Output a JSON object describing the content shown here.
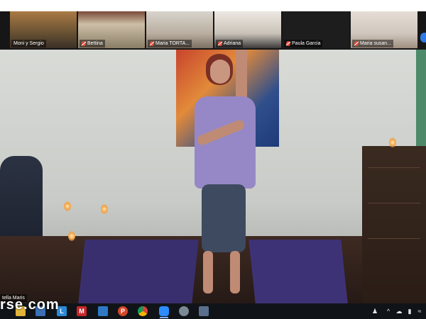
{
  "participants": [
    {
      "name": "Moni y Sergio",
      "muted": false
    },
    {
      "name": "Bettina",
      "muted": true
    },
    {
      "name": "Maria TORTA...",
      "muted": true
    },
    {
      "name": "Adriana",
      "muted": true
    },
    {
      "name": "Paula Garcia",
      "muted": true
    },
    {
      "name": "Maria susan...",
      "muted": true
    }
  ],
  "speaker": {
    "name": "tella Maris"
  },
  "watermark": "rse.com",
  "taskbar": {
    "apps": [
      {
        "icon": "file-explorer-icon",
        "label": ""
      },
      {
        "icon": "store-icon",
        "label": ""
      },
      {
        "icon": "launcher-l-icon",
        "label": "L"
      },
      {
        "icon": "mcafee-icon",
        "label": "M"
      },
      {
        "icon": "mail-icon",
        "label": ""
      },
      {
        "icon": "powerpoint-icon",
        "label": "P"
      },
      {
        "icon": "chrome-icon",
        "label": ""
      },
      {
        "icon": "zoom-icon",
        "label": ""
      },
      {
        "icon": "snipping-tool-icon",
        "label": ""
      },
      {
        "icon": "photos-icon",
        "label": ""
      }
    ],
    "tray": {
      "people_icon": "people-icon",
      "chevron": "^",
      "cloud_icon": "onedrive-icon",
      "battery_icon": "battery-icon",
      "wifi_icon": "wifi-icon"
    }
  },
  "colors": {
    "accent": "#2c7be5",
    "muted_mic": "#e04b3a",
    "active_speaker": "#f3d63a"
  }
}
